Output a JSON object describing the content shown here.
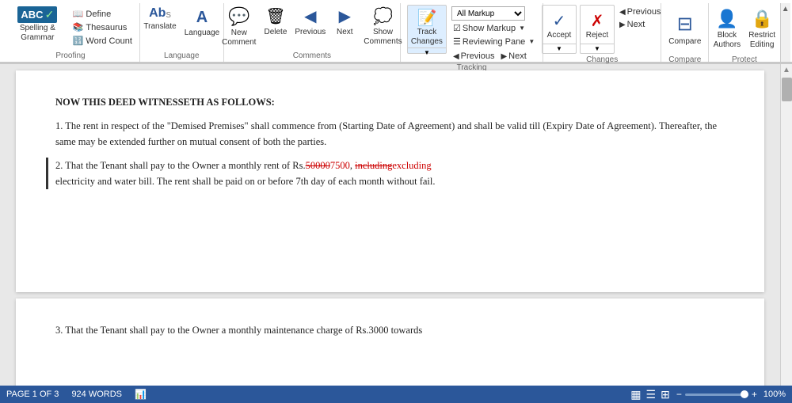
{
  "ribbon": {
    "groups": [
      {
        "name": "Proofing",
        "label": "Proofing",
        "items": [
          {
            "id": "spelling-grammar",
            "label": "Spelling &\nGrammar",
            "icon": "✓"
          },
          {
            "id": "define",
            "label": "Define",
            "icon": ""
          },
          {
            "id": "thesaurus",
            "label": "Thesaurus",
            "icon": ""
          },
          {
            "id": "word-count",
            "label": "Word Count",
            "icon": ""
          }
        ]
      },
      {
        "name": "Language",
        "label": "Language",
        "items": [
          {
            "id": "translate",
            "label": "Translate",
            "icon": "Aa"
          },
          {
            "id": "language",
            "label": "Language",
            "icon": "A"
          }
        ]
      },
      {
        "name": "Comments",
        "label": "Comments",
        "items": [
          {
            "id": "new-comment",
            "label": "New\nComment",
            "icon": "💬"
          },
          {
            "id": "delete",
            "label": "Delete",
            "icon": "🗑"
          },
          {
            "id": "previous",
            "label": "Previous",
            "icon": "◀"
          },
          {
            "id": "next",
            "label": "Next",
            "icon": "▶"
          },
          {
            "id": "show-comments",
            "label": "Show\nComments",
            "icon": "💭"
          }
        ]
      },
      {
        "name": "Tracking",
        "label": "Tracking",
        "items": [
          {
            "id": "track-changes",
            "label": "Track\nChanges",
            "icon": "📝"
          },
          {
            "id": "all-markup",
            "label": "All Markup",
            "icon": ""
          },
          {
            "id": "show-markup",
            "label": "Show Markup",
            "icon": ""
          },
          {
            "id": "reviewing-pane",
            "label": "Reviewing Pane",
            "icon": ""
          },
          {
            "id": "previous-track",
            "label": "Previous",
            "icon": ""
          },
          {
            "id": "next-track",
            "label": "Next",
            "icon": ""
          }
        ]
      },
      {
        "name": "Changes",
        "label": "Changes",
        "items": [
          {
            "id": "accept",
            "label": "Accept",
            "icon": "✓"
          },
          {
            "id": "reject",
            "label": "Reject",
            "icon": "✗"
          },
          {
            "id": "previous-change",
            "label": "Previous",
            "icon": "◀"
          },
          {
            "id": "next-change",
            "label": "Next",
            "icon": "▶"
          }
        ]
      },
      {
        "name": "Compare",
        "label": "Compare",
        "items": [
          {
            "id": "compare",
            "label": "Compare",
            "icon": "⊟"
          }
        ]
      },
      {
        "name": "Protect",
        "label": "Protect",
        "items": [
          {
            "id": "block-authors",
            "label": "Block\nAuthors",
            "icon": "👤"
          },
          {
            "id": "restrict-editing",
            "label": "Restrict\nEditing",
            "icon": "🔒"
          }
        ]
      }
    ]
  },
  "document": {
    "pages": [
      {
        "id": "page1",
        "paragraphs": [
          {
            "id": "p1",
            "text": "NOW THIS DEED WITNESSETH AS FOLLOWS:",
            "bold": true,
            "has_change": false
          },
          {
            "id": "p2",
            "number": "1.",
            "text": " The rent in respect of the \"Demised Premises\" shall commence from (Starting Date of Agreement) and shall be valid till (Expiry Date of Agreement). Thereafter, the same may be extended further on mutual consent of both the parties.",
            "has_change": false
          },
          {
            "id": "p3",
            "number": "2.",
            "text_before": " That the Tenant shall pay to the Owner a monthly rent of Rs.",
            "deleted_text": "50000",
            "inserted_text": "7500",
            "text_middle": ", ",
            "deleted_text2": "including",
            "inserted_text2": "excluding",
            "text_after": "\nelectricity and water bill. The rent shall be paid on or before 7th day of each month without fail.",
            "has_change": true
          }
        ]
      },
      {
        "id": "page2",
        "paragraphs": [
          {
            "id": "p4",
            "number": "3.",
            "text": " That the Tenant shall pay to the Owner a monthly maintenance charge of Rs.3000 towards",
            "has_change": false
          }
        ]
      }
    ]
  },
  "status_bar": {
    "page_info": "PAGE 1 OF 3",
    "word_count": "924 WORDS",
    "zoom_level": "100%",
    "icons": [
      "layout1",
      "layout2",
      "layout3"
    ]
  }
}
